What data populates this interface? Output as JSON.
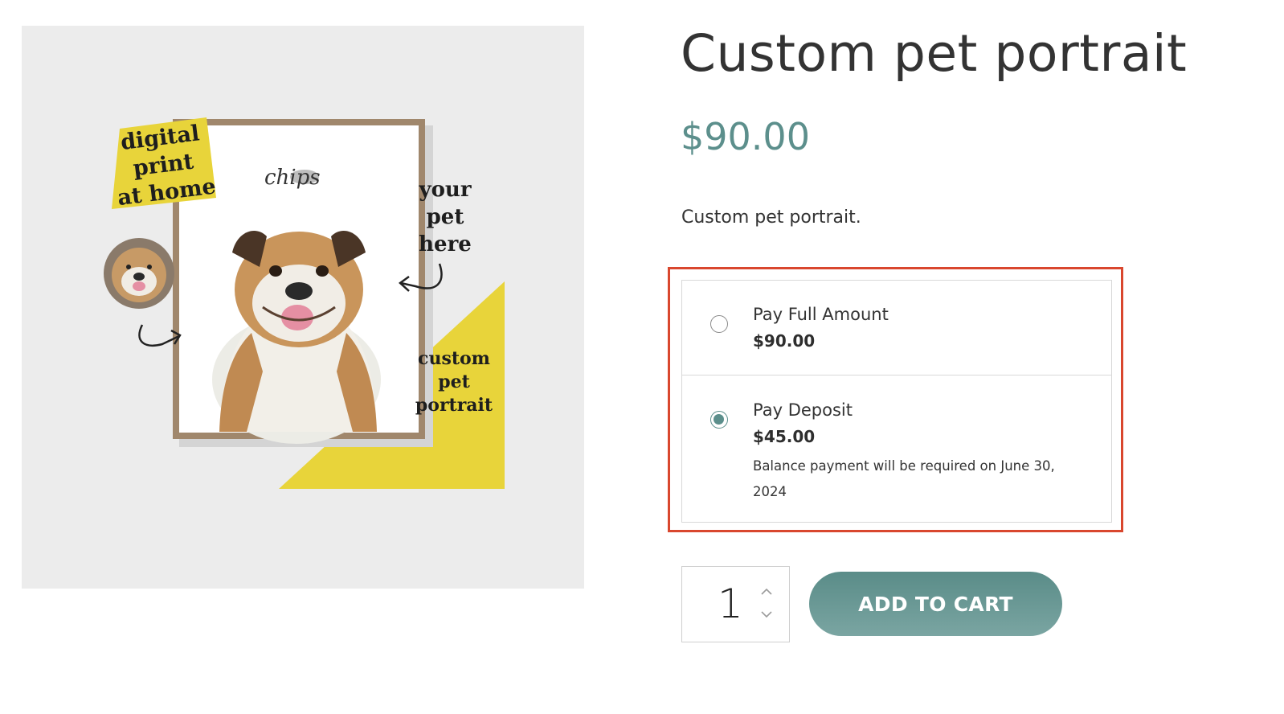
{
  "product": {
    "title": "Custom pet portrait",
    "price": "$90.00",
    "description": "Custom pet portrait.",
    "image": {
      "tag_top_left": [
        "digital",
        "print",
        "at home"
      ],
      "tag_right": [
        "your",
        "pet",
        "here"
      ],
      "tag_bottom_right": [
        "custom",
        "pet",
        "portrait"
      ],
      "pet_name": "chips"
    }
  },
  "payment_options": [
    {
      "label": "Pay Full Amount",
      "amount": "$90.00",
      "selected": false
    },
    {
      "label": "Pay Deposit",
      "amount": "$45.00",
      "selected": true,
      "note": "Balance payment will be required on June 30, 2024"
    }
  ],
  "quantity": {
    "value": "1"
  },
  "cart": {
    "button_label": "ADD TO CART"
  },
  "colors": {
    "accent": "#5c8f8c",
    "highlight_border": "#d9472e",
    "tag_yellow": "#e8d43a"
  },
  "icons": {
    "stepper_up": "chevron-up-icon",
    "stepper_down": "chevron-down-icon"
  }
}
